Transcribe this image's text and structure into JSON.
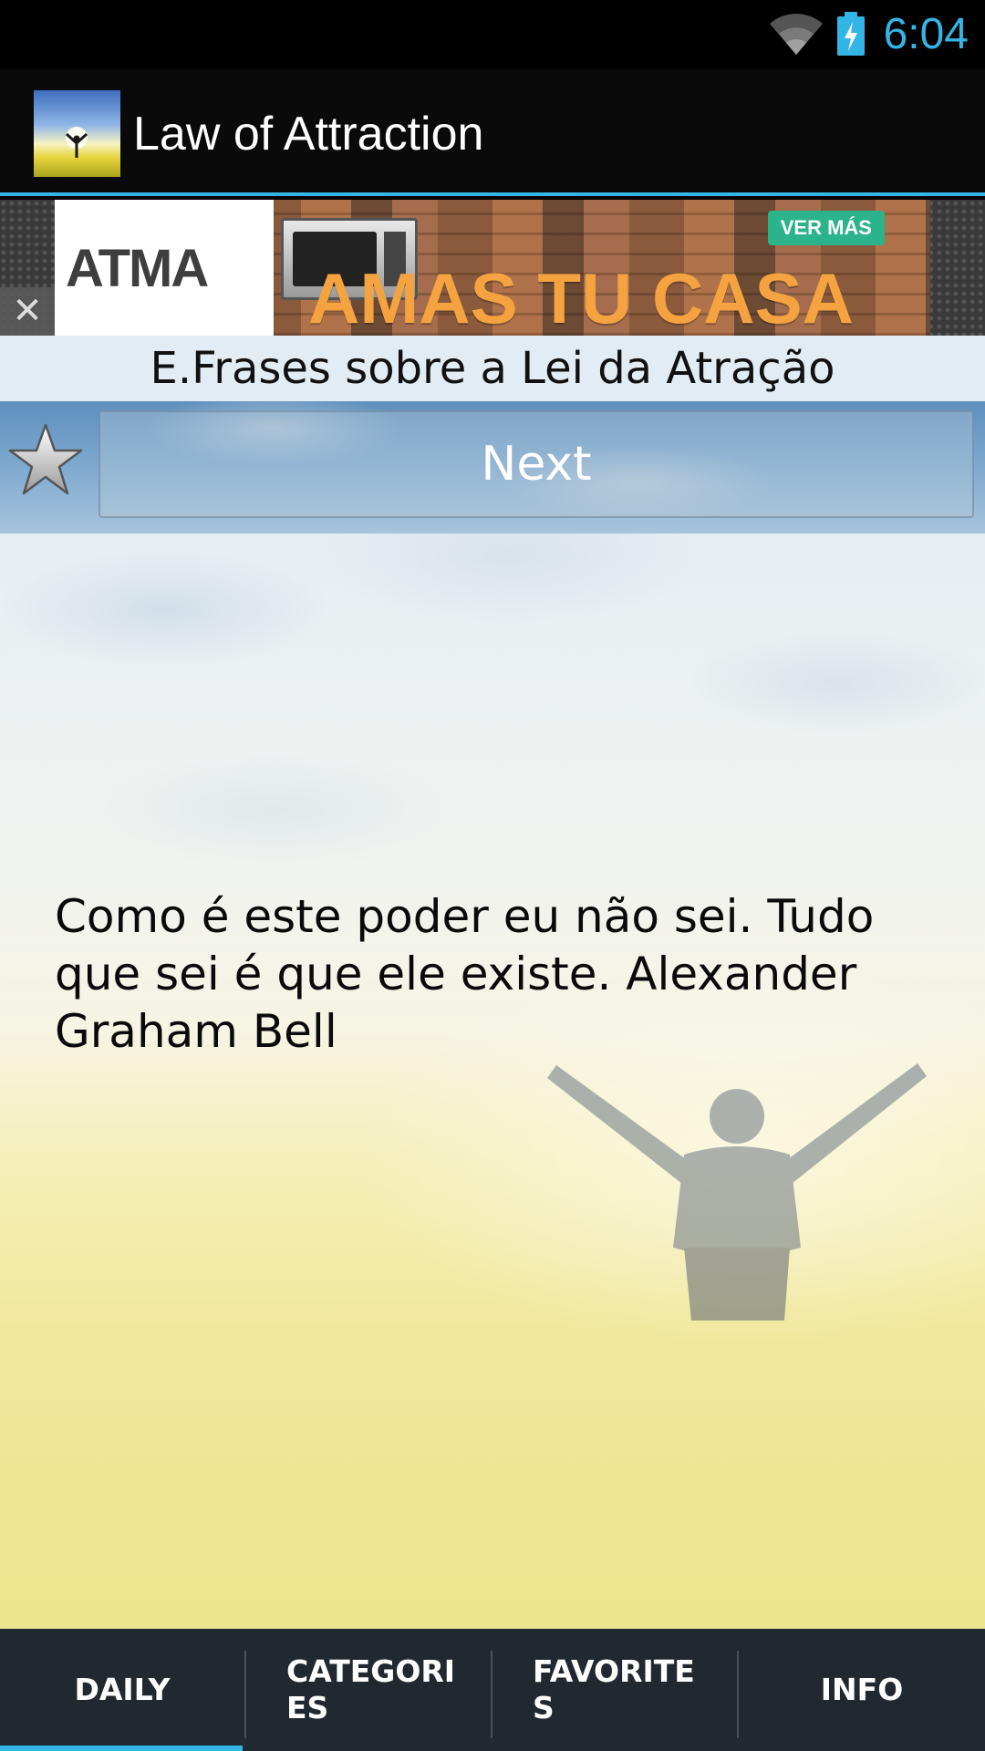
{
  "status_bar": {
    "time": "6:04",
    "icons": [
      "wifi-icon",
      "battery-charging-icon"
    ],
    "accent_color": "#33b5e5"
  },
  "action_bar": {
    "title": "Law of Attraction",
    "icon": "app-icon"
  },
  "ad": {
    "brand": "ATMA",
    "headline": "AMAS TU CASA",
    "cta": "VER MÁS",
    "close_icon": "close-icon"
  },
  "main": {
    "category_title": "E.Frases sobre a Lei da Atração",
    "next_label": "Next",
    "favorite_icon": "star-icon",
    "quote": "Como é este poder eu não sei. Tudo que sei é que ele existe. Alexander Graham Bell"
  },
  "tabs": {
    "items": [
      {
        "label": "DAILY",
        "selected": true
      },
      {
        "label": "CATEGORI ES",
        "selected": false
      },
      {
        "label": "FAVORITE S",
        "selected": false
      },
      {
        "label": "INFO",
        "selected": false
      }
    ],
    "selected_color": "#33b5e5"
  }
}
